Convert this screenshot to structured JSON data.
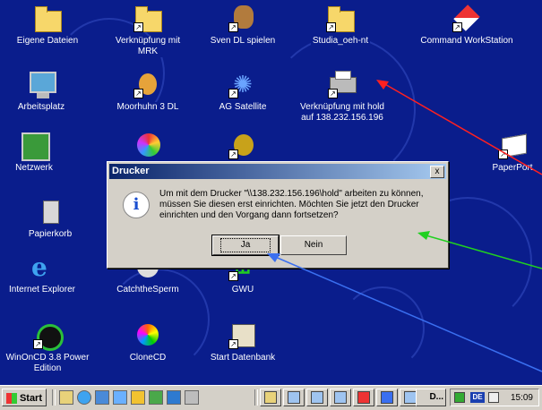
{
  "desktop": {
    "icons": [
      {
        "label": "Eigene Dateien",
        "icon": "my-documents-folder-icon"
      },
      {
        "label": "Verknüpfung mit MRK",
        "icon": "folder-shortcut-icon"
      },
      {
        "label": "Sven DL spielen",
        "icon": "game-character-icon"
      },
      {
        "label": "Studia_oeh-nt",
        "icon": "network-folder-icon"
      },
      {
        "label": "Command WorkStation",
        "icon": "command-workstation-icon"
      },
      {
        "label": "Arbeitsplatz",
        "icon": "my-computer-icon"
      },
      {
        "label": "Moorhuhn 3 DL",
        "icon": "moorhuhn-chicken-icon"
      },
      {
        "label": "AG Satellite",
        "icon": "satellite-icon"
      },
      {
        "label": "Verknüpfung mit hold auf 138.232.156.196",
        "icon": "printer-shortcut-icon"
      },
      {
        "label": "Netzwerk",
        "icon": "network-neighborhood-icon"
      },
      {
        "label": "PaperPort",
        "icon": "paperport-icon"
      },
      {
        "label": "Papierkorb",
        "icon": "recycle-bin-icon"
      },
      {
        "label": "Internet Explorer",
        "icon": "internet-explorer-icon"
      },
      {
        "label": "CatchtheSperm",
        "icon": "catch-the-sperm-icon"
      },
      {
        "label": "GWU",
        "icon": "gwu-icon"
      },
      {
        "label": "WinOnCD 3.8 Power Edition",
        "icon": "winoncd-icon"
      },
      {
        "label": "CloneCD",
        "icon": "clonecd-icon"
      },
      {
        "label": "Start Datenbank",
        "icon": "database-icon"
      }
    ]
  },
  "dialog": {
    "title": "Drucker",
    "close_label": "x",
    "message_line1": "Um mit dem Drucker \"\\\\138.232.156.196\\hold\" arbeiten zu können,",
    "message_line2": "müssen Sie diesen erst einrichten. Möchten Sie jetzt den Drucker",
    "message_line3": "einrichten und den Vorgang dann fortsetzen?",
    "yes_label": "Ja",
    "no_label": "Nein",
    "info_glyph": "i"
  },
  "annotation_arrows": {
    "colors": [
      "#ff2020",
      "#20d020",
      "#3a6ff0"
    ]
  },
  "taskbar": {
    "start_label": "Start",
    "task_button_label": "D...",
    "language": "DE",
    "clock": "15:09"
  },
  "colors": {
    "desktop": "#0a1d8c",
    "title_bar": "#0a246a",
    "face": "#d4d0c8"
  }
}
